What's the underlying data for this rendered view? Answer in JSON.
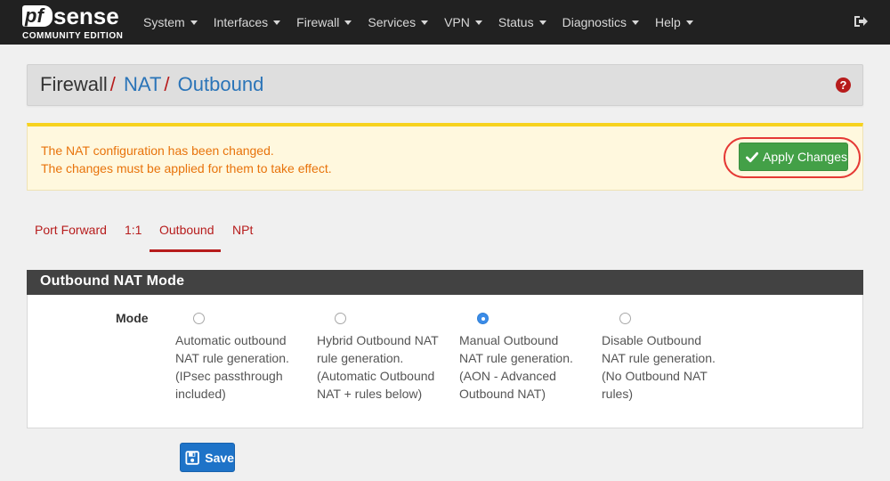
{
  "brand": {
    "pf": "pf",
    "sense": "sense",
    "edition": "COMMUNITY EDITION"
  },
  "nav": {
    "items": [
      {
        "label": "System"
      },
      {
        "label": "Interfaces"
      },
      {
        "label": "Firewall"
      },
      {
        "label": "Services"
      },
      {
        "label": "VPN"
      },
      {
        "label": "Status"
      },
      {
        "label": "Diagnostics"
      },
      {
        "label": "Help"
      }
    ],
    "logout_icon": "sign-out-icon"
  },
  "breadcrumb": {
    "root": "Firewall",
    "separator": "/",
    "level2": "NAT",
    "level3": "Outbound",
    "help_icon": "question-circle-icon",
    "help_glyph": "?"
  },
  "alert": {
    "line1": "The NAT configuration has been changed.",
    "line2": "The changes must be applied for them to take effect.",
    "apply_label": "Apply Changes",
    "apply_icon": "check-icon"
  },
  "tabs": [
    {
      "label": "Port Forward"
    },
    {
      "label": "1:1"
    },
    {
      "label": "Outbound",
      "active": true
    },
    {
      "label": "NPt"
    }
  ],
  "panel": {
    "title": "Outbound NAT Mode",
    "mode_label": "Mode",
    "options": [
      {
        "text": "Automatic outbound NAT rule generation. (IPsec passthrough included)",
        "checked": false
      },
      {
        "text": "Hybrid Outbound NAT rule generation. (Automatic Outbound NAT + rules below)",
        "checked": false
      },
      {
        "text": "Manual Outbound NAT rule generation. (AON - Advanced Outbound NAT)",
        "checked": true
      },
      {
        "text": "Disable Outbound NAT rule generation. (No Outbound NAT rules)",
        "checked": false
      }
    ]
  },
  "save": {
    "label": "Save",
    "icon": "save-icon"
  },
  "colors": {
    "navbar": "#212121",
    "accent_red": "#b71c1c",
    "link_blue": "#2a74b8",
    "alert_text": "#e8730b",
    "alert_bg": "#fff8de",
    "apply_green": "#43a047",
    "save_blue": "#1e73c8",
    "highlight_ring": "#e53935"
  }
}
